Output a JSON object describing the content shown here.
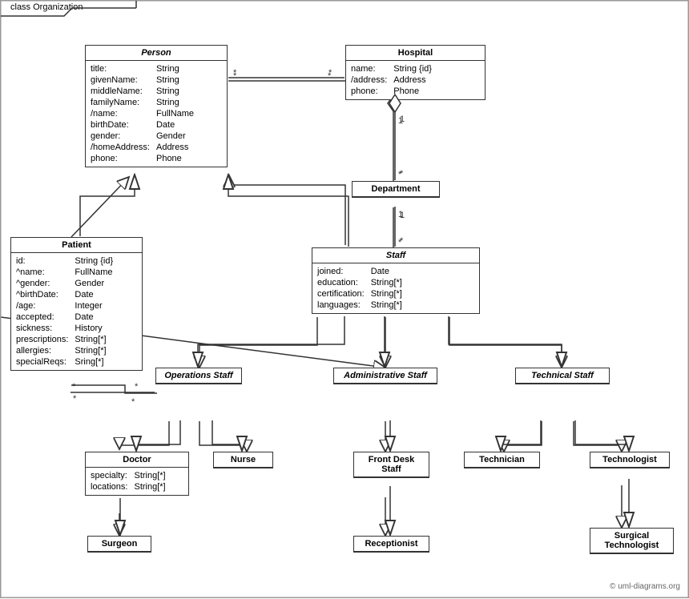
{
  "diagram": {
    "title": "class Organization",
    "classes": {
      "person": {
        "name": "Person",
        "italic": true,
        "attributes": [
          [
            "title:",
            "String"
          ],
          [
            "givenName:",
            "String"
          ],
          [
            "middleName:",
            "String"
          ],
          [
            "familyName:",
            "String"
          ],
          [
            "/name:",
            "FullName"
          ],
          [
            "birthDate:",
            "Date"
          ],
          [
            "gender:",
            "Gender"
          ],
          [
            "/homeAddress:",
            "Address"
          ],
          [
            "phone:",
            "Phone"
          ]
        ]
      },
      "hospital": {
        "name": "Hospital",
        "italic": false,
        "attributes": [
          [
            "name:",
            "String {id}"
          ],
          [
            "/address:",
            "Address"
          ],
          [
            "phone:",
            "Phone"
          ]
        ]
      },
      "patient": {
        "name": "Patient",
        "italic": false,
        "attributes": [
          [
            "id:",
            "String {id}"
          ],
          [
            "^name:",
            "FullName"
          ],
          [
            "^gender:",
            "Gender"
          ],
          [
            "^birthDate:",
            "Date"
          ],
          [
            "/age:",
            "Integer"
          ],
          [
            "accepted:",
            "Date"
          ],
          [
            "sickness:",
            "History"
          ],
          [
            "prescriptions:",
            "String[*]"
          ],
          [
            "allergies:",
            "String[*]"
          ],
          [
            "specialReqs:",
            "Sring[*]"
          ]
        ]
      },
      "department": {
        "name": "Department",
        "italic": false,
        "attributes": []
      },
      "staff": {
        "name": "Staff",
        "italic": true,
        "attributes": [
          [
            "joined:",
            "Date"
          ],
          [
            "education:",
            "String[*]"
          ],
          [
            "certification:",
            "String[*]"
          ],
          [
            "languages:",
            "String[*]"
          ]
        ]
      },
      "operations_staff": {
        "name": "Operations Staff",
        "italic": true,
        "attributes": []
      },
      "administrative_staff": {
        "name": "Administrative Staff",
        "italic": true,
        "attributes": []
      },
      "technical_staff": {
        "name": "Technical Staff",
        "italic": true,
        "attributes": []
      },
      "doctor": {
        "name": "Doctor",
        "italic": false,
        "attributes": [
          [
            "specialty:",
            "String[*]"
          ],
          [
            "locations:",
            "String[*]"
          ]
        ]
      },
      "nurse": {
        "name": "Nurse",
        "italic": false,
        "attributes": []
      },
      "front_desk_staff": {
        "name": "Front Desk Staff",
        "italic": false,
        "attributes": []
      },
      "technician": {
        "name": "Technician",
        "italic": false,
        "attributes": []
      },
      "technologist": {
        "name": "Technologist",
        "italic": false,
        "attributes": []
      },
      "surgeon": {
        "name": "Surgeon",
        "italic": false,
        "attributes": []
      },
      "receptionist": {
        "name": "Receptionist",
        "italic": false,
        "attributes": []
      },
      "surgical_technologist": {
        "name": "Surgical Technologist",
        "italic": false,
        "attributes": []
      }
    },
    "copyright": "© uml-diagrams.org"
  }
}
